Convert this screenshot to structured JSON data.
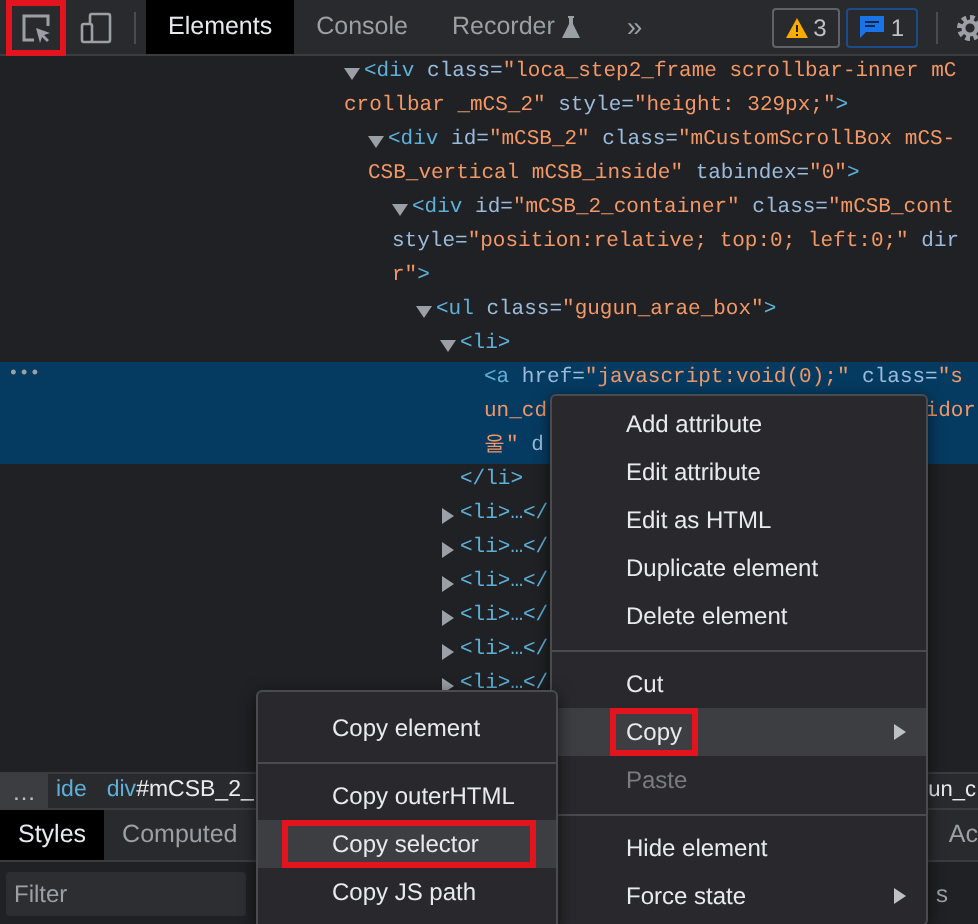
{
  "toolbar": {
    "tools": [
      {
        "kind": "inspect",
        "annotated": true
      },
      {
        "kind": "device",
        "annotated": false
      }
    ],
    "tabs": [
      {
        "label": "Elements",
        "selected": true,
        "experimental": false
      },
      {
        "label": "Console",
        "selected": false,
        "experimental": false
      },
      {
        "label": "Recorder",
        "selected": false,
        "experimental": true
      }
    ],
    "overflow": "»",
    "badges": [
      {
        "kind": "warning",
        "count": "3"
      },
      {
        "kind": "message",
        "count": "1"
      }
    ]
  },
  "dom_tree": [
    {
      "expanded": true,
      "selected": false,
      "lines": [
        [
          {
            "kind": "tag",
            "text": "<div"
          },
          {
            "kind": "attr",
            "text": " class="
          },
          {
            "kind": "value",
            "text": "\"loca_step2_frame scrollbar-inner mC"
          }
        ],
        [
          {
            "kind": "value",
            "text": "crollbar _mCS_2\""
          },
          {
            "kind": "attr",
            "text": " style="
          },
          {
            "kind": "value",
            "text": "\"height: 329px;\""
          },
          {
            "kind": "tag",
            "text": ">"
          }
        ]
      ],
      "children": [
        {
          "expanded": true,
          "selected": false,
          "lines": [
            [
              {
                "kind": "tag",
                "text": "<div"
              },
              {
                "kind": "attr",
                "text": " id="
              },
              {
                "kind": "value",
                "text": "\"mCSB_2\""
              },
              {
                "kind": "attr",
                "text": " class="
              },
              {
                "kind": "value",
                "text": "\"mCustomScrollBox mCS-"
              }
            ],
            [
              {
                "kind": "value",
                "text": "CSB_vertical mCSB_inside\""
              },
              {
                "kind": "attr",
                "text": " tabindex="
              },
              {
                "kind": "value",
                "text": "\"0\""
              },
              {
                "kind": "tag",
                "text": ">"
              }
            ]
          ],
          "children": [
            {
              "expanded": true,
              "selected": false,
              "lines": [
                [
                  {
                    "kind": "tag",
                    "text": "<div"
                  },
                  {
                    "kind": "attr",
                    "text": " id="
                  },
                  {
                    "kind": "value",
                    "text": "\"mCSB_2_container\""
                  },
                  {
                    "kind": "attr",
                    "text": " class="
                  },
                  {
                    "kind": "value",
                    "text": "\"mCSB_cont"
                  }
                ],
                [
                  {
                    "kind": "attr",
                    "text": "style="
                  },
                  {
                    "kind": "value",
                    "text": "\"position:relative; top:0; left:0;\""
                  },
                  {
                    "kind": "attr",
                    "text": " dir"
                  }
                ],
                [
                  {
                    "kind": "value",
                    "text": "r\""
                  },
                  {
                    "kind": "tag",
                    "text": ">"
                  }
                ]
              ],
              "children": [
                {
                  "expanded": true,
                  "selected": false,
                  "lines": [
                    [
                      {
                        "kind": "tag",
                        "text": "<ul"
                      },
                      {
                        "kind": "attr",
                        "text": " class="
                      },
                      {
                        "kind": "value",
                        "text": "\"gugun_arae_box\""
                      },
                      {
                        "kind": "tag",
                        "text": ">"
                      }
                    ]
                  ],
                  "children": [
                    {
                      "expanded": true,
                      "selected": false,
                      "lines": [
                        [
                          {
                            "kind": "tag",
                            "text": "<li>"
                          }
                        ]
                      ],
                      "closing": [
                        {
                          "kind": "tag",
                          "text": "</li>"
                        }
                      ],
                      "children": [
                        {
                          "selected": true,
                          "lines": [
                            [
                              {
                                "kind": "tag",
                                "text": "<a"
                              },
                              {
                                "kind": "attr",
                                "text": " href="
                              },
                              {
                                "kind": "value",
                                "text": "\"javascript:void(0);\""
                              },
                              {
                                "kind": "attr",
                                "text": " class="
                              },
                              {
                                "kind": "value",
                                "text": "\"s"
                              }
                            ],
                            [
                              {
                                "kind": "value",
                                "text": "un_cd"
                              },
                              {
                                "kind": "value",
                                "text": "idor",
                                "right": true
                              }
                            ],
                            [
                              {
                                "kind": "value",
                                "text": "울\""
                              },
                              {
                                "kind": "attr",
                                "text": " d"
                              }
                            ]
                          ]
                        }
                      ]
                    },
                    {
                      "expanded": false,
                      "selected": false,
                      "lines": [
                        [
                          {
                            "kind": "tag",
                            "text": "<li>…</"
                          }
                        ]
                      ]
                    },
                    {
                      "expanded": false,
                      "selected": false,
                      "lines": [
                        [
                          {
                            "kind": "tag",
                            "text": "<li>…</"
                          }
                        ]
                      ]
                    },
                    {
                      "expanded": false,
                      "selected": false,
                      "lines": [
                        [
                          {
                            "kind": "tag",
                            "text": "<li>…</"
                          }
                        ]
                      ]
                    },
                    {
                      "expanded": false,
                      "selected": false,
                      "lines": [
                        [
                          {
                            "kind": "tag",
                            "text": "<li>…</"
                          }
                        ]
                      ]
                    },
                    {
                      "expanded": false,
                      "selected": false,
                      "lines": [
                        [
                          {
                            "kind": "tag",
                            "text": "<li>…</"
                          }
                        ]
                      ]
                    },
                    {
                      "expanded": false,
                      "selected": false,
                      "lines": [
                        [
                          {
                            "kind": "tag",
                            "text": "<li>…</"
                          }
                        ]
                      ]
                    }
                  ]
                }
              ]
            }
          ]
        }
      ]
    }
  ],
  "selected_marker": "•••",
  "breadcrumbs": {
    "overflow": "…",
    "items": [
      {
        "tag": "ide"
      },
      {
        "tag": "div",
        "id": "#mCSB_2_"
      }
    ],
    "right": "un_c"
  },
  "styles_tabs": {
    "tabs": [
      {
        "label": "Styles",
        "selected": true
      },
      {
        "label": "Computed",
        "selected": false
      }
    ],
    "right": "Ac"
  },
  "filter": {
    "placeholder": "Filter",
    "right": "s"
  },
  "context_menu": [
    {
      "kind": "item",
      "label": "Add attribute",
      "submenu": false,
      "disabled": false,
      "selected": false,
      "annotated": false
    },
    {
      "kind": "item",
      "label": "Edit attribute",
      "submenu": false,
      "disabled": false,
      "selected": false,
      "annotated": false
    },
    {
      "kind": "item",
      "label": "Edit as HTML",
      "submenu": false,
      "disabled": false,
      "selected": false,
      "annotated": false
    },
    {
      "kind": "item",
      "label": "Duplicate element",
      "submenu": false,
      "disabled": false,
      "selected": false,
      "annotated": false
    },
    {
      "kind": "item",
      "label": "Delete element",
      "submenu": false,
      "disabled": false,
      "selected": false,
      "annotated": false
    },
    {
      "kind": "separator"
    },
    {
      "kind": "item",
      "label": "Cut",
      "submenu": false,
      "disabled": false,
      "selected": false,
      "annotated": false
    },
    {
      "kind": "item",
      "label": "Copy",
      "submenu": true,
      "disabled": false,
      "selected": true,
      "annotated": true
    },
    {
      "kind": "item",
      "label": "Paste",
      "submenu": false,
      "disabled": true,
      "selected": false,
      "annotated": false
    },
    {
      "kind": "separator"
    },
    {
      "kind": "item",
      "label": "Hide element",
      "submenu": false,
      "disabled": false,
      "selected": false,
      "annotated": false
    },
    {
      "kind": "item",
      "label": "Force state",
      "submenu": true,
      "disabled": false,
      "selected": false,
      "annotated": false
    }
  ],
  "copy_submenu": [
    {
      "kind": "item",
      "label": "Copy element",
      "submenu": false,
      "disabled": false,
      "selected": false,
      "annotated": false
    },
    {
      "kind": "separator"
    },
    {
      "kind": "item",
      "label": "Copy outerHTML",
      "submenu": false,
      "disabled": false,
      "selected": false,
      "annotated": false
    },
    {
      "kind": "item",
      "label": "Copy selector",
      "submenu": false,
      "disabled": false,
      "selected": true,
      "annotated": true
    },
    {
      "kind": "item",
      "label": "Copy JS path",
      "submenu": false,
      "disabled": false,
      "selected": false,
      "annotated": false
    }
  ]
}
